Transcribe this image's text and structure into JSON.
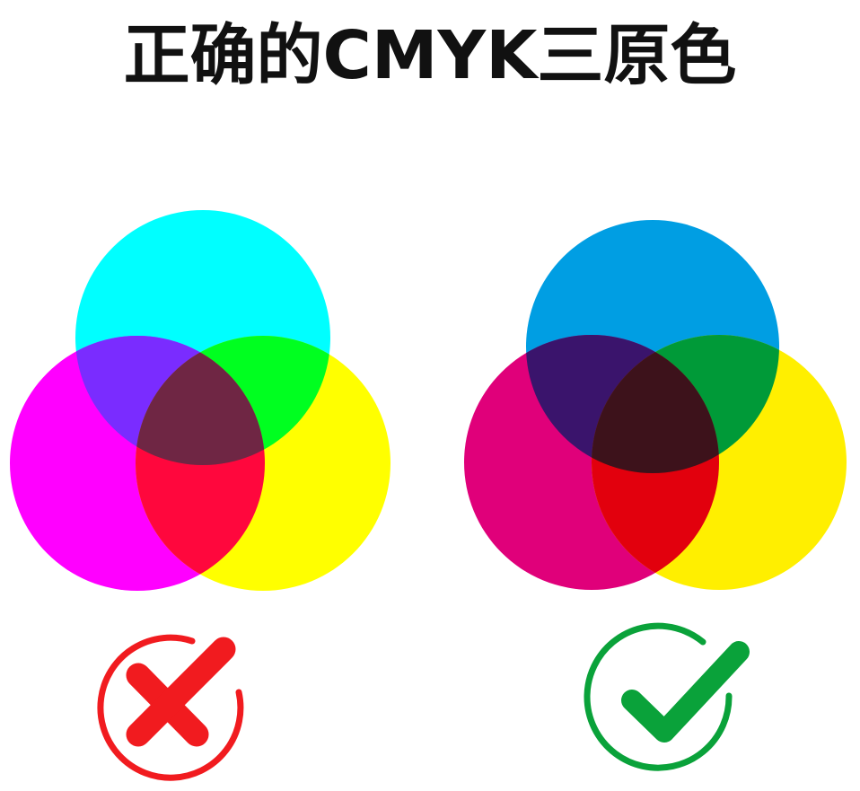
{
  "title": "正确的CMYK三原色",
  "diagrams": [
    {
      "verdict": "incorrect",
      "colors": {
        "top": "#00ffff",
        "left": "#ff00ff",
        "right": "#ffff00",
        "top_left": "#7a2cff",
        "top_right": "#00ff20",
        "left_right": "#ff073d",
        "center": "#6f2644"
      }
    },
    {
      "verdict": "correct",
      "colors": {
        "top": "#009ee3",
        "left": "#e0007a",
        "right": "#ffef00",
        "top_left": "#3a146c",
        "top_right": "#009a38",
        "left_right": "#e2000d",
        "center": "#3d121b"
      }
    }
  ],
  "icons": {
    "cross_icon": "cross-icon",
    "check_icon": "check-icon",
    "cross_color": "#f11b1f",
    "check_color": "#0aa23a"
  }
}
